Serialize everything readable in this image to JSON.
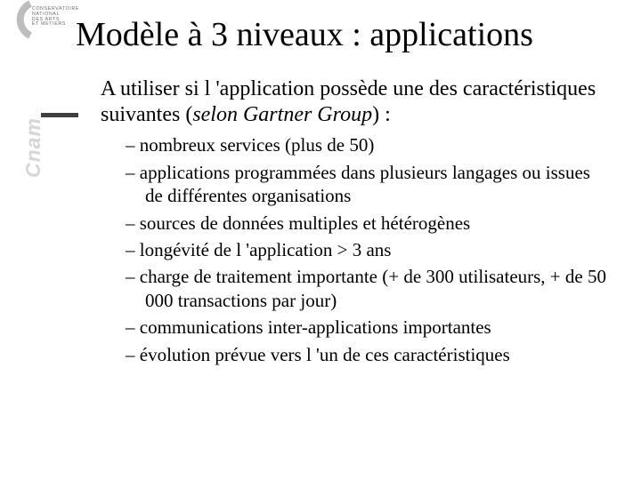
{
  "brand": {
    "vertical_word": "Cnam",
    "tagline": "CONSERVATOIRE\nNATIONAL\nDES ARTS\nET METIERS"
  },
  "title": "Modèle à 3 niveaux : applications",
  "intro_prefix": "A utiliser si l 'application possède une des caractéristiques suivantes (",
  "intro_italic": "selon Gartner Group",
  "intro_suffix": ") :",
  "bullets": [
    "nombreux services (plus de 50)",
    "applications programmées dans plusieurs langages ou issues de différentes organisations",
    "sources de données multiples et hétérogènes",
    "longévité de l 'application > 3 ans",
    "charge de traitement importante (+ de 300 utilisateurs, + de 50 000 transactions par jour)",
    "communications inter-applications importantes",
    "évolution prévue vers l 'un de ces caractéristiques"
  ]
}
